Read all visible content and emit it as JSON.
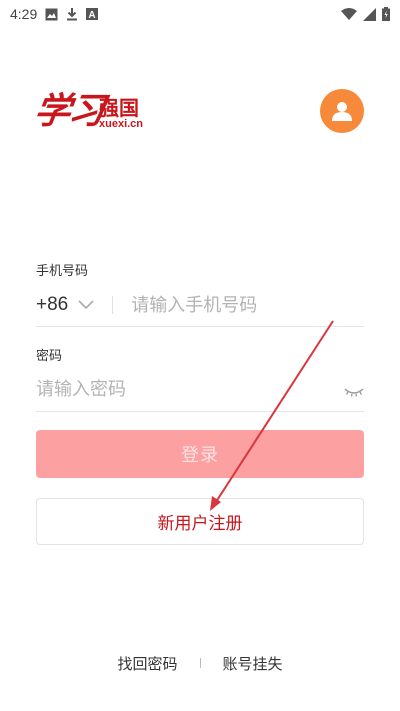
{
  "status_bar": {
    "time": "4:29",
    "left_icons": [
      "image-icon",
      "download-icon",
      "font-icon"
    ],
    "right_icons": [
      "wifi-icon",
      "signal-icon",
      "battery-icon"
    ]
  },
  "logo": {
    "script_text": "学习",
    "main_text": "强国",
    "domain": "xuexi.cn",
    "color": "#c9161d"
  },
  "avatar": {
    "icon": "user-icon",
    "color": "#f68a3a"
  },
  "phone": {
    "label": "手机号码",
    "country_code": "+86",
    "placeholder": "请输入手机号码",
    "value": ""
  },
  "password": {
    "label": "密码",
    "placeholder": "请输入密码",
    "value": "",
    "toggle_icon": "eye-closed-icon"
  },
  "login_button": {
    "label": "登录",
    "color": "#fd9b9c"
  },
  "register_button": {
    "label": "新用户注册"
  },
  "bottom_links": {
    "forgot_password": "找回密码",
    "account_lost": "账号挂失"
  },
  "annotation_arrow_color": "#d9363e"
}
